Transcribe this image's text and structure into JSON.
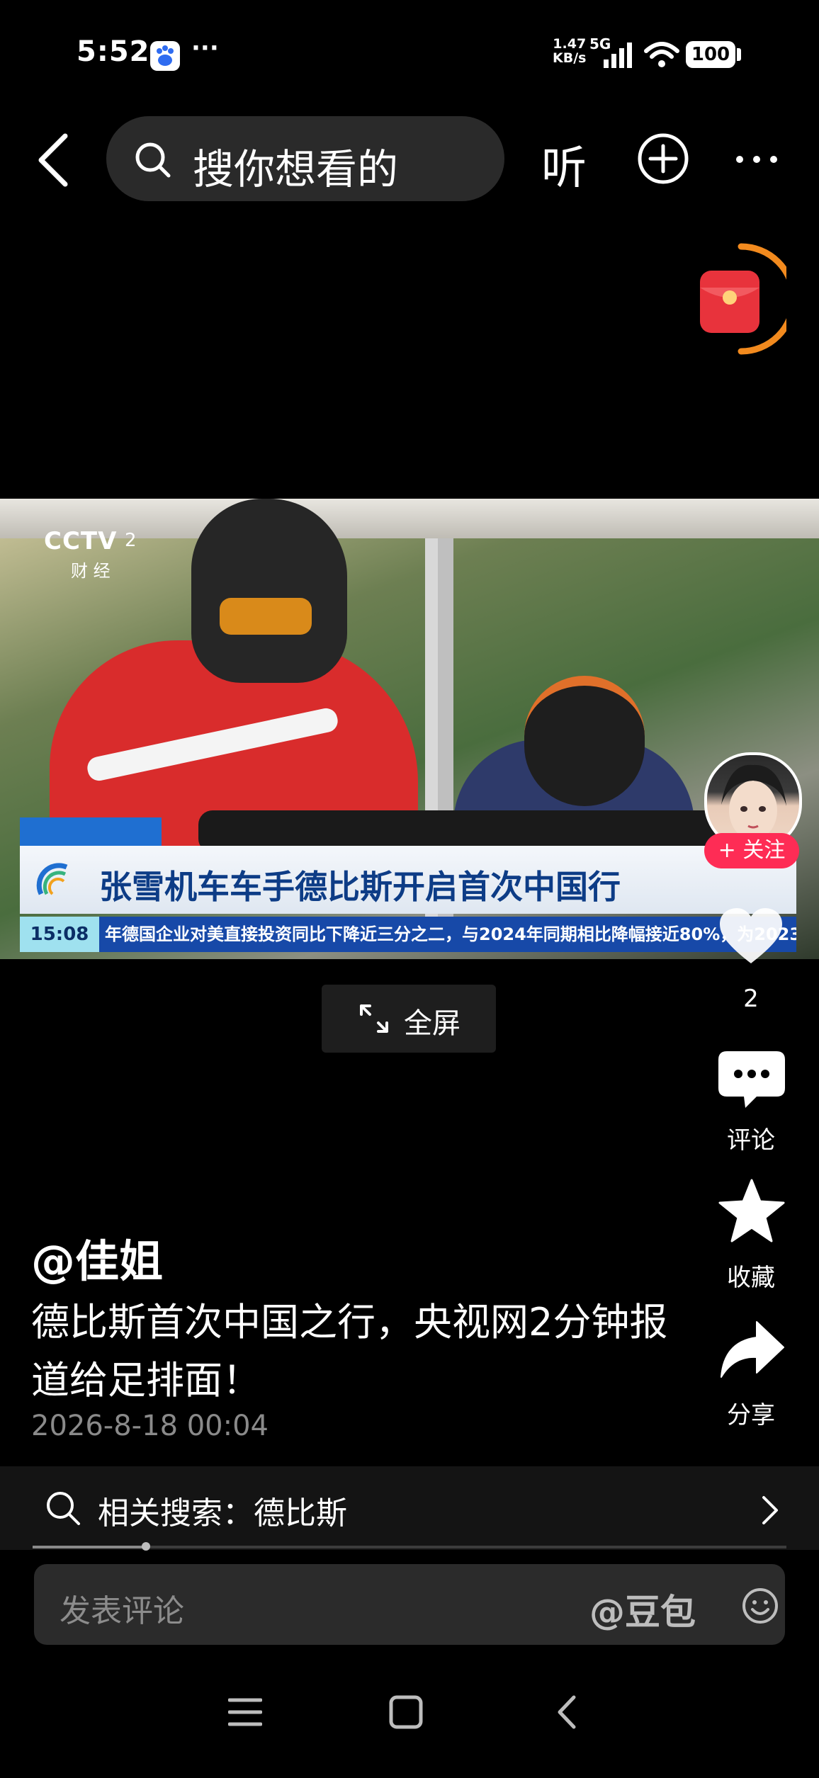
{
  "status_bar": {
    "time": "5:52",
    "dots": "···",
    "net_speed_value": "1.47",
    "net_speed_unit": "KB/s",
    "net_type": "5G",
    "battery": "100"
  },
  "top_nav": {
    "search_placeholder": "搜你想看的",
    "listen_label": "听"
  },
  "video": {
    "channel_logo": "CCTV",
    "channel_number": "2",
    "channel_sub": "财 经",
    "headline": "张雪机车车手德比斯开启首次中国行",
    "ticker_time": "15:08",
    "ticker_text": "年德国企业对美直接投资同比下降近三分之二，与2024年同期相比降幅接近80%，为2023"
  },
  "fullscreen": {
    "label": "全屏"
  },
  "side_actions": {
    "follow_label": "+ 关注",
    "like_count": "2",
    "comment_label": "评论",
    "favorite_label": "收藏",
    "share_label": "分享"
  },
  "post": {
    "author": "@佳姐",
    "caption": "德比斯首次中国之行，央视网2分钟报道给足排面！",
    "date": "2026-8-18 00:04"
  },
  "related_search": {
    "label": "相关搜索：德比斯"
  },
  "playback": {
    "progress": 0.15
  },
  "comment_bar": {
    "placeholder": "发表评论",
    "mention": "@豆包"
  },
  "colors": {
    "background": "#000000",
    "follow_red": "#fe2c55",
    "redpacket_red": "#e8333c",
    "redpacket_ring": "#f28a1e"
  }
}
